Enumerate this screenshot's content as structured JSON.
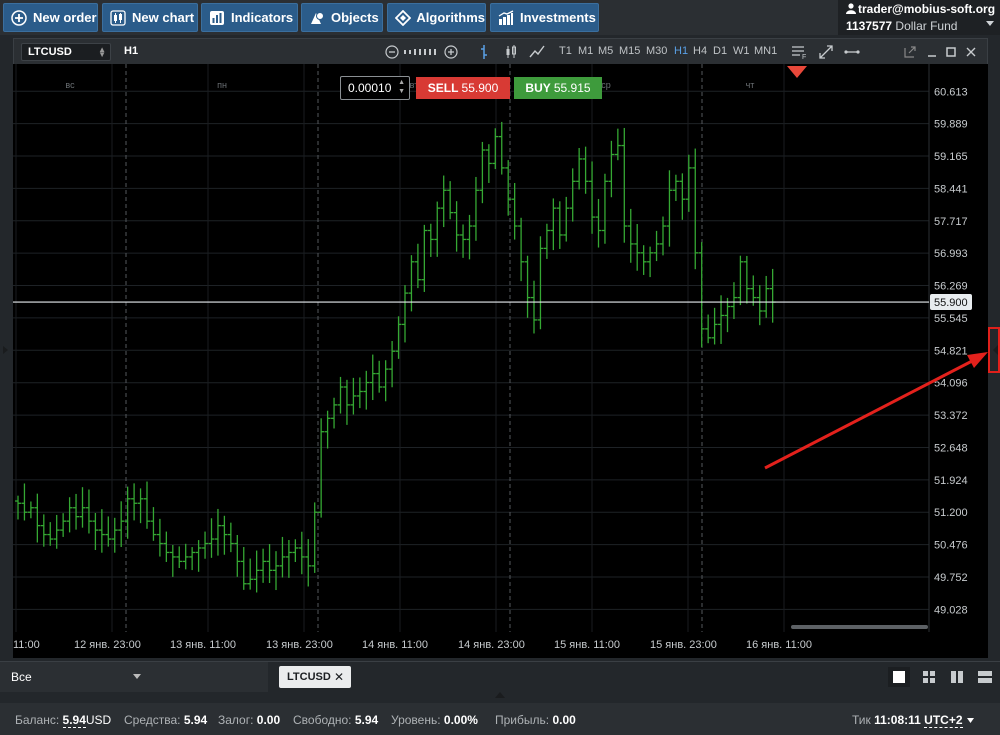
{
  "toolbar": {
    "new_order": "New order",
    "new_chart": "New chart",
    "indicators": "Indicators",
    "objects": "Objects",
    "algorithms": "Algorithms",
    "investments": "Investments"
  },
  "account": {
    "user": "trader@mobius-soft.org",
    "number": "1137577",
    "name": "Dollar Fund"
  },
  "chart_toolbar": {
    "symbol": "LTCUSD",
    "timeframe": "H1",
    "timeframes": [
      "T1",
      "M1",
      "M5",
      "M15",
      "M30",
      "H1",
      "H4",
      "D1",
      "W1",
      "MN1"
    ],
    "active_timeframe": "H1"
  },
  "order_panel": {
    "volume": "0.00010",
    "sell_label": "SELL",
    "sell_price": "55.900",
    "buy_label": "BUY",
    "buy_price": "55.915"
  },
  "bottom": {
    "filter": "Все",
    "tab": "LTCUSD"
  },
  "status": {
    "balance_label": "Баланс:",
    "balance_value": "5.94",
    "balance_ccy": "USD",
    "equity_label": "Средства:",
    "equity_value": "5.94",
    "margin_label": "Залог:",
    "margin_value": "0.00",
    "free_label": "Свободно:",
    "free_value": "5.94",
    "level_label": "Уровень:",
    "level_value": "0.00%",
    "profit_label": "Прибыль:",
    "profit_value": "0.00",
    "tick_label": "Тик",
    "tick_time": "11:08:11",
    "timezone": "UTC+2"
  },
  "chart_data": {
    "type": "line",
    "style": "ohlc-bars",
    "series_color": "#35a833",
    "current_price": "55.900",
    "ylim": [
      48.7,
      61.0
    ],
    "y_ticks": [
      "60.613",
      "59.889",
      "59.165",
      "58.441",
      "57.717",
      "56.993",
      "56.269",
      "55.545",
      "54.821",
      "54.096",
      "53.372",
      "52.648",
      "51.924",
      "51.200",
      "50.476",
      "49.752",
      "49.028"
    ],
    "x_ticks": [
      "11:00",
      "12 янв. 23:00",
      "13 янв. 11:00",
      "13 янв. 23:00",
      "14 янв. 11:00",
      "14 янв. 23:00",
      "15 янв. 11:00",
      "15 янв. 23:00",
      "16 янв. 11:00"
    ],
    "day_labels": [
      "вс",
      "пн",
      "вт",
      "ср",
      "чт"
    ],
    "closes": [
      51.4,
      51.2,
      51.3,
      50.9,
      50.7,
      50.6,
      50.8,
      51.0,
      51.3,
      51.1,
      51.3,
      51.0,
      50.8,
      50.7,
      50.6,
      50.8,
      51.0,
      51.5,
      51.4,
      51.5,
      51.0,
      50.7,
      50.5,
      50.3,
      50.2,
      50.1,
      50.2,
      50.3,
      50.4,
      50.5,
      50.6,
      50.9,
      50.7,
      50.5,
      50.1,
      49.6,
      49.7,
      49.9,
      50.1,
      49.9,
      50.0,
      50.2,
      50.3,
      50.4,
      50.2,
      50.0,
      51.2,
      53.0,
      53.3,
      53.6,
      54.0,
      53.6,
      53.8,
      53.9,
      54.1,
      54.3,
      54.0,
      54.4,
      54.8,
      55.4,
      56.1,
      56.8,
      56.4,
      57.5,
      57.3,
      58.0,
      58.4,
      57.9,
      57.4,
      57.3,
      57.6,
      58.4,
      59.3,
      59.0,
      59.6,
      58.9,
      58.2,
      57.6,
      56.8,
      56.0,
      55.5,
      57.1,
      57.5,
      58.0,
      57.4,
      58.0,
      58.6,
      59.1,
      58.6,
      57.8,
      57.5,
      58.6,
      59.2,
      59.4,
      57.6,
      57.2,
      57.0,
      56.8,
      57.0,
      57.2,
      57.6,
      58.4,
      58.6,
      58.2,
      58.9,
      57.0,
      55.3,
      55.1,
      55.4,
      55.6,
      55.8,
      56.0,
      56.8,
      56.2,
      56.0,
      55.7,
      56.2,
      55.9
    ]
  }
}
